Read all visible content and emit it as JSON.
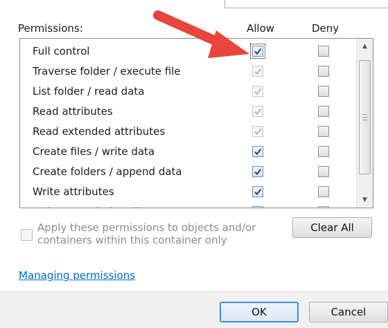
{
  "headers": {
    "permissions": "Permissions:",
    "allow": "Allow",
    "deny": "Deny"
  },
  "permissions": [
    {
      "name": "Full control",
      "allow": "checked",
      "deny": "unchecked"
    },
    {
      "name": "Traverse folder / execute file",
      "allow": "checked-disabled",
      "deny": "unchecked"
    },
    {
      "name": "List folder / read data",
      "allow": "checked-disabled",
      "deny": "unchecked"
    },
    {
      "name": "Read attributes",
      "allow": "checked-disabled",
      "deny": "unchecked"
    },
    {
      "name": "Read extended attributes",
      "allow": "checked-disabled",
      "deny": "unchecked"
    },
    {
      "name": "Create files / write data",
      "allow": "checked",
      "deny": "unchecked"
    },
    {
      "name": "Create folders / append data",
      "allow": "checked",
      "deny": "unchecked"
    },
    {
      "name": "Write attributes",
      "allow": "checked",
      "deny": "unchecked"
    },
    {
      "name": "Write extended attributes",
      "allow": "checked",
      "deny": "unchecked"
    }
  ],
  "apply_option": {
    "label": "Apply these permissions to objects and/or containers within this container only",
    "checked": false,
    "enabled": false
  },
  "buttons": {
    "clear_all": "Clear All",
    "ok": "OK",
    "cancel": "Cancel"
  },
  "link": {
    "managing_permissions": "Managing permissions"
  },
  "icons": {
    "checkmark": "check-icon",
    "scroll_up": "triangle-up-icon",
    "scroll_down": "triangle-down-icon",
    "annotation_arrow": "red-arrow-icon"
  },
  "colors": {
    "link": "#0066cc",
    "checkmark": "#1e3f8a",
    "checkmark_disabled": "#b5b5b5",
    "default_button_border": "#3c8be6",
    "arrow": "#e8453c"
  }
}
